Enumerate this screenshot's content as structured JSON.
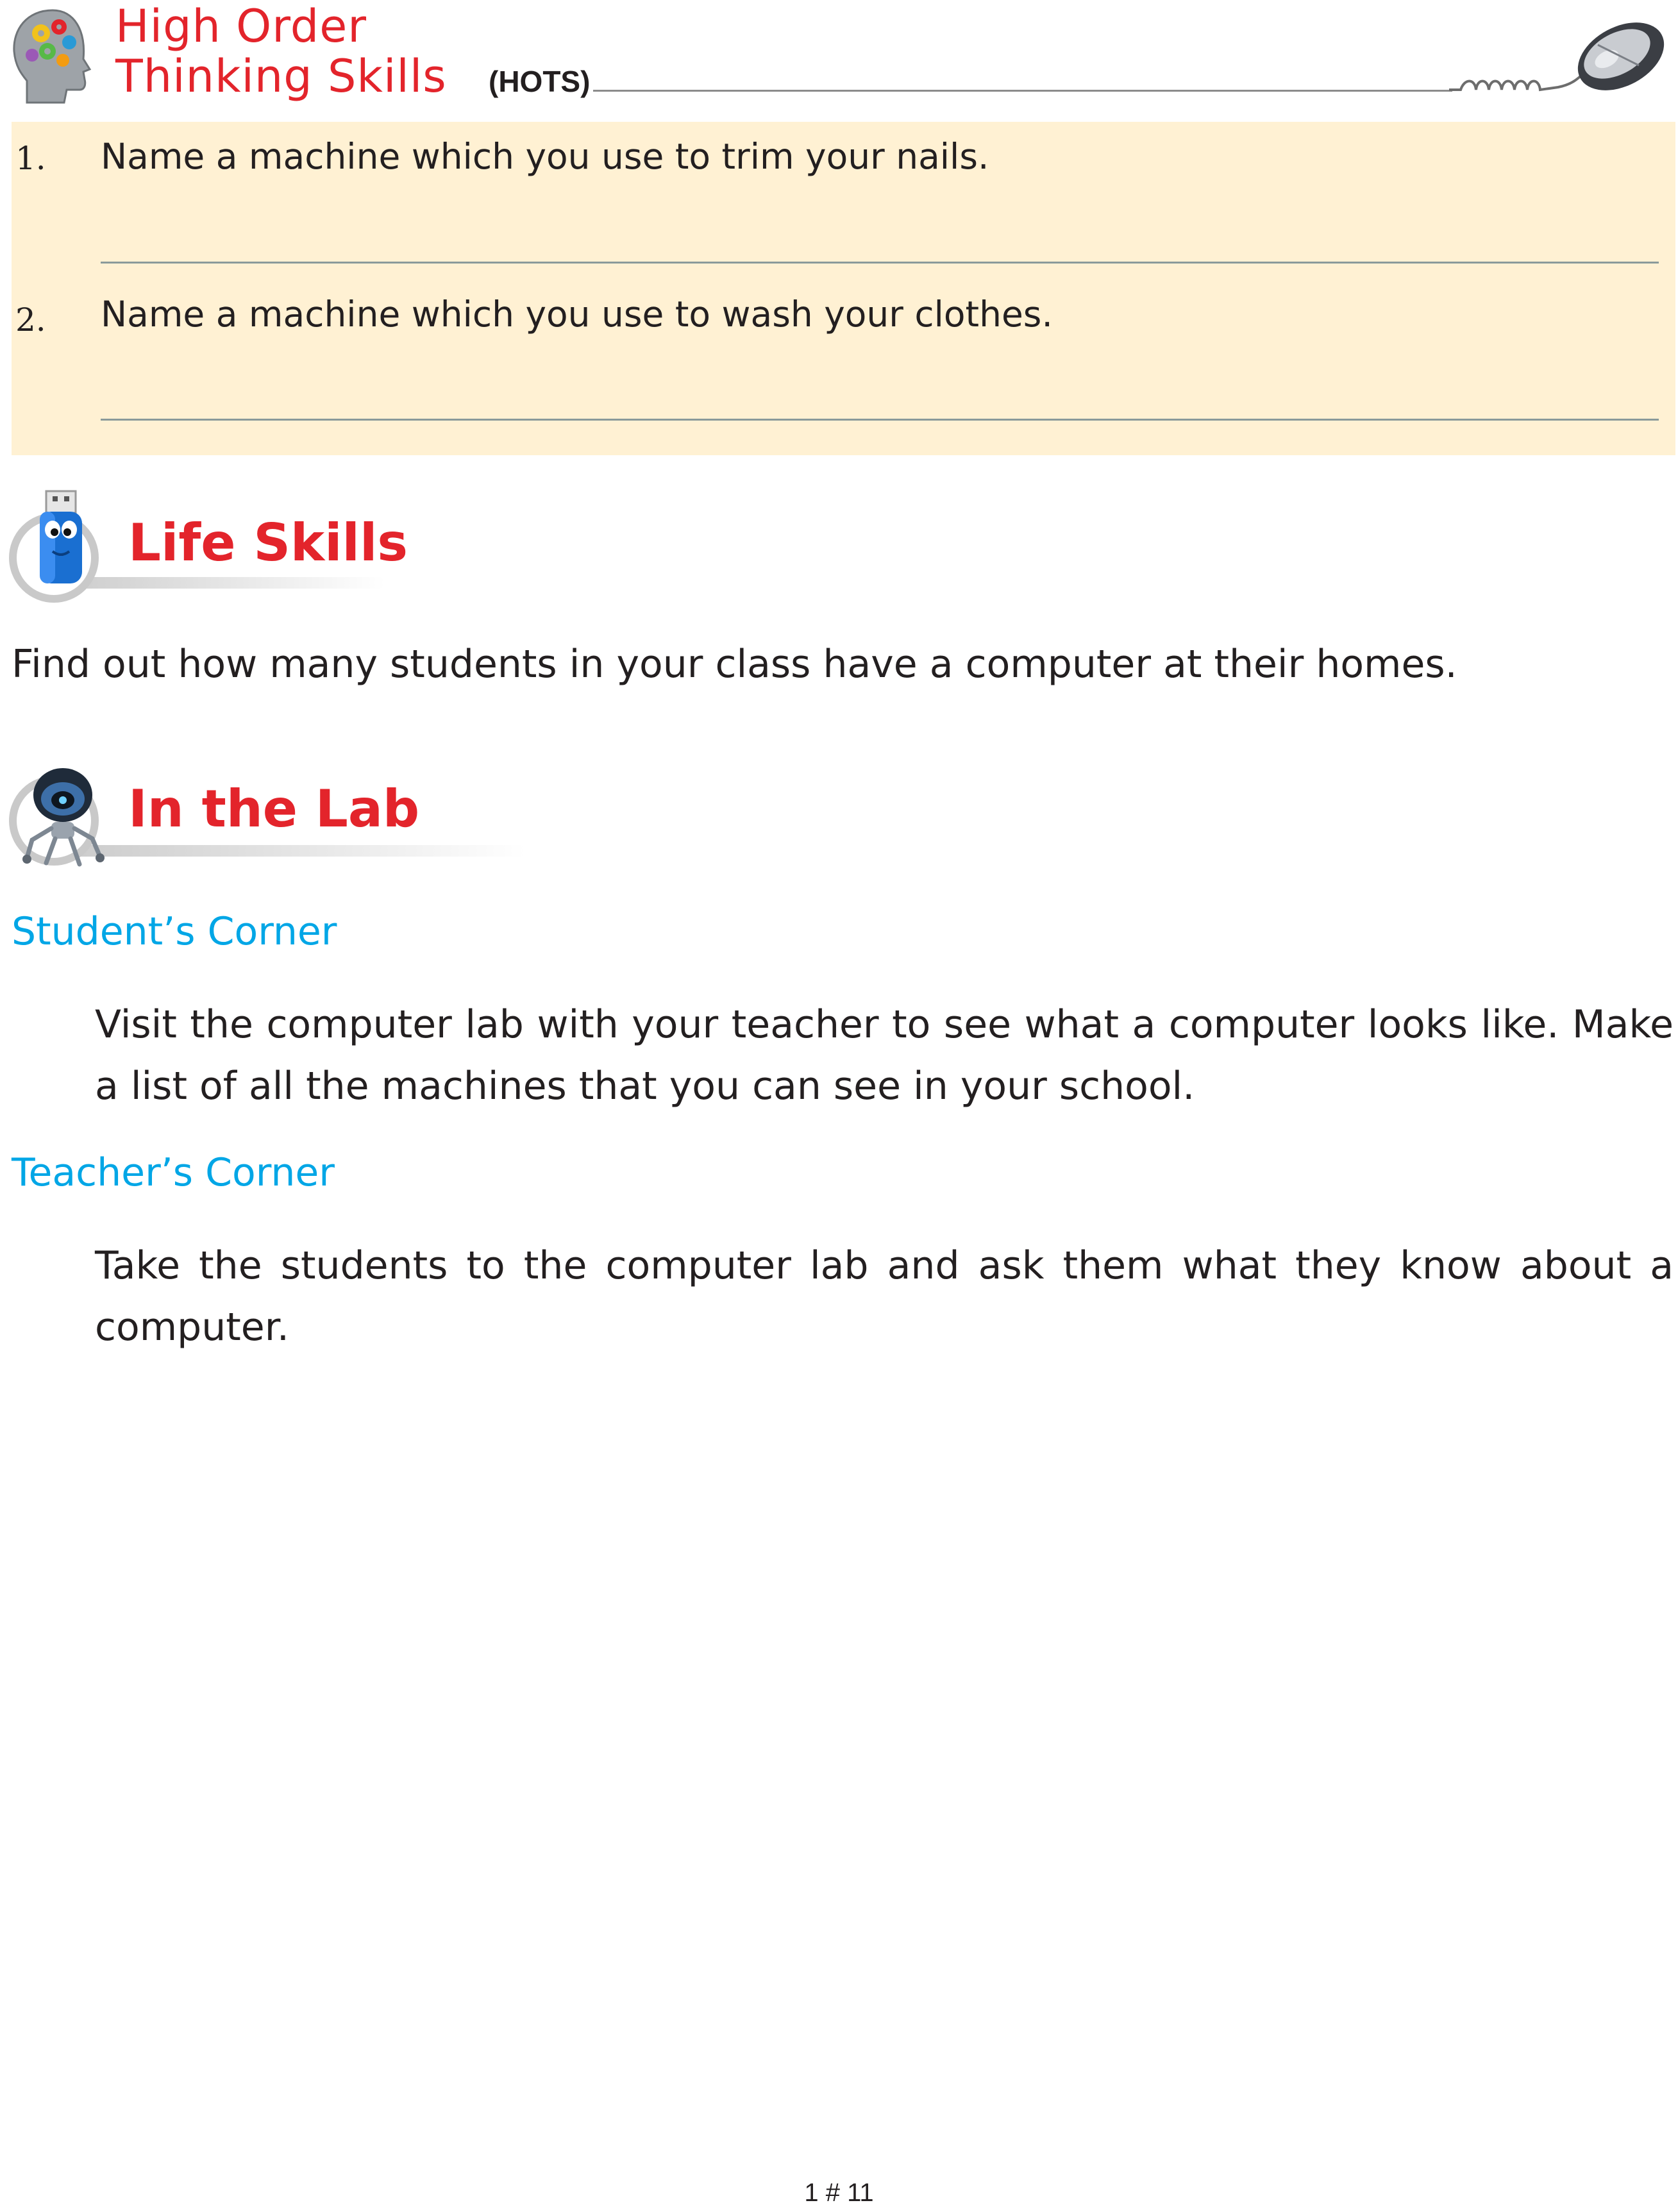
{
  "hots": {
    "title_line1": "High Order",
    "title_line2": "Thinking Skills",
    "abbr": "(HOTS)",
    "questions": [
      {
        "num": "1.",
        "text": "Name a machine which you use to trim your nails."
      },
      {
        "num": "2.",
        "text": "Name a machine which you use to wash your clothes."
      }
    ]
  },
  "life_skills": {
    "title": "Life Skills",
    "text": "Find out how many students in your class have a computer at their homes."
  },
  "lab": {
    "title": "In the Lab",
    "students_corner": {
      "title": "Student’s Corner",
      "text": "Visit the computer lab with your teacher to see what a computer looks like. Make a list of all the machines that you can see in your school."
    },
    "teachers_corner": {
      "title": "Teacher’s Corner",
      "text": "Take the students to the computer lab and ask them what they know about a computer."
    }
  },
  "footer": {
    "page": "1 # 11"
  },
  "colors": {
    "heading_red": "#e3242b",
    "corner_blue": "#00a6e6",
    "hots_box": "#fff1d3"
  },
  "icons": [
    "brain-gears-icon",
    "computer-mouse-icon",
    "usb-drive-icon",
    "robot-icon"
  ]
}
